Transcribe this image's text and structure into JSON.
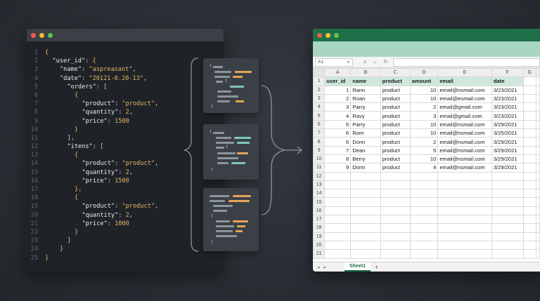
{
  "editor": {
    "lines": [
      {
        "n": "1",
        "indent": 0,
        "parts": [
          [
            "brace",
            "{"
          ]
        ]
      },
      {
        "n": "2",
        "indent": 1,
        "parts": [
          [
            "key",
            "\"user_id\""
          ],
          [
            "punct",
            ": "
          ],
          [
            "brace",
            "{"
          ]
        ]
      },
      {
        "n": "3",
        "indent": 2,
        "parts": [
          [
            "key",
            "\"name\""
          ],
          [
            "punct",
            ": "
          ],
          [
            "str",
            "\"aspreasant\""
          ],
          [
            "punct",
            ","
          ]
        ]
      },
      {
        "n": "4",
        "indent": 2,
        "parts": [
          [
            "key",
            "\"date\""
          ],
          [
            "punct",
            ": "
          ],
          [
            "str",
            "\"20121-0.20-13\""
          ],
          [
            "punct",
            ","
          ]
        ]
      },
      {
        "n": "5",
        "indent": 3,
        "parts": [
          [
            "key",
            "\"orders\""
          ],
          [
            "punct",
            ": ["
          ]
        ]
      },
      {
        "n": "6",
        "indent": 4,
        "parts": [
          [
            "brace",
            "{"
          ]
        ]
      },
      {
        "n": "7",
        "indent": 5,
        "parts": [
          [
            "key",
            "\"product\""
          ],
          [
            "punct",
            ": "
          ],
          [
            "str",
            "\"product\""
          ],
          [
            "punct",
            ","
          ]
        ]
      },
      {
        "n": "8",
        "indent": 5,
        "parts": [
          [
            "key",
            "\"quantity\""
          ],
          [
            "punct",
            ": "
          ],
          [
            "num",
            "2"
          ],
          [
            "punct",
            ","
          ]
        ]
      },
      {
        "n": "9",
        "indent": 5,
        "parts": [
          [
            "key",
            "\"price\""
          ],
          [
            "punct",
            ": "
          ],
          [
            "num",
            "1500"
          ]
        ]
      },
      {
        "n": "10",
        "indent": 4,
        "parts": [
          [
            "brace",
            "}"
          ]
        ]
      },
      {
        "n": "11",
        "indent": 3,
        "parts": [
          [
            "punct",
            "],"
          ]
        ]
      },
      {
        "n": "12",
        "indent": 3,
        "parts": [
          [
            "key",
            "\"itens\""
          ],
          [
            "punct",
            ": ["
          ]
        ]
      },
      {
        "n": "13",
        "indent": 4,
        "parts": [
          [
            "brace",
            "{"
          ]
        ]
      },
      {
        "n": "14",
        "indent": 5,
        "parts": [
          [
            "key",
            "\"product\""
          ],
          [
            "punct",
            ": "
          ],
          [
            "str",
            "\"product\""
          ],
          [
            "punct",
            ","
          ]
        ]
      },
      {
        "n": "15",
        "indent": 5,
        "parts": [
          [
            "key",
            "\"quantity\""
          ],
          [
            "punct",
            ": "
          ],
          [
            "num",
            "2"
          ],
          [
            "punct",
            ","
          ]
        ]
      },
      {
        "n": "16",
        "indent": 5,
        "parts": [
          [
            "key",
            "\"price\""
          ],
          [
            "punct",
            ": "
          ],
          [
            "num",
            "1500"
          ]
        ]
      },
      {
        "n": "17",
        "indent": 4,
        "parts": [
          [
            "brace",
            "},"
          ]
        ]
      },
      {
        "n": "18",
        "indent": 4,
        "parts": [
          [
            "brace",
            "{"
          ]
        ]
      },
      {
        "n": "19",
        "indent": 5,
        "parts": [
          [
            "key",
            "\"product\""
          ],
          [
            "punct",
            ": "
          ],
          [
            "str",
            "\"product\""
          ],
          [
            "punct",
            ","
          ]
        ]
      },
      {
        "n": "20",
        "indent": 5,
        "parts": [
          [
            "key",
            "\"quantity\""
          ],
          [
            "punct",
            ": "
          ],
          [
            "num",
            "2"
          ],
          [
            "punct",
            ","
          ]
        ]
      },
      {
        "n": "21",
        "indent": 5,
        "parts": [
          [
            "key",
            "\"price\""
          ],
          [
            "punct",
            ": "
          ],
          [
            "num",
            "1000"
          ]
        ]
      },
      {
        "n": "22",
        "indent": 4,
        "parts": [
          [
            "brace",
            "}"
          ]
        ]
      },
      {
        "n": "23",
        "indent": 3,
        "parts": [
          [
            "punct",
            "]"
          ]
        ]
      },
      {
        "n": "24",
        "indent": 2,
        "parts": [
          [
            "brace",
            "}"
          ]
        ]
      },
      {
        "n": "25",
        "indent": 0,
        "parts": [
          [
            "brace",
            "}"
          ]
        ]
      }
    ]
  },
  "sheet": {
    "name_box": "A1",
    "icons": {
      "cancel": "✕",
      "confirm": "✓",
      "function": "fx"
    },
    "columns": [
      "A",
      "B",
      "C",
      "D",
      "E",
      "F",
      "G"
    ],
    "headers": [
      "user_id",
      "name",
      "product",
      "amount",
      "email",
      "date",
      ""
    ],
    "rows": [
      [
        "1",
        "Rann",
        "product",
        "10",
        "email@nsmail.com",
        "3/23/2021",
        ""
      ],
      [
        "2",
        "Roan",
        "product",
        "10",
        "email@esmail.com",
        "3/23/2021",
        ""
      ],
      [
        "3",
        "Parry",
        "product",
        "2",
        "email@gmail.com",
        "3/23/2021",
        ""
      ],
      [
        "4",
        "Ravy",
        "product",
        "3",
        "email@gmail.com",
        "3/23/2021",
        ""
      ],
      [
        "5",
        "Parry",
        "product",
        "10",
        "email@nsmail.com",
        "3/29/2021",
        ""
      ],
      [
        "6",
        "Rom",
        "product",
        "10",
        "email@nsmail.com",
        "3/25/2021",
        ""
      ],
      [
        "6",
        "Donn",
        "product",
        "2",
        "email@nsmail.com",
        "3/29/2021",
        ""
      ],
      [
        "7",
        "Dean",
        "product",
        "5",
        "email@nsmail.com",
        "3/29/2021",
        ""
      ],
      [
        "8",
        "Berry",
        "product",
        "10",
        "email@nsmail.com",
        "3/29/2021",
        ""
      ],
      [
        "9",
        "Donn",
        "product",
        "4",
        "email@nsmail.com",
        "3/29/2021",
        ""
      ]
    ],
    "row_numbers": [
      "1",
      "2",
      "3",
      "4",
      "5",
      "6",
      "7",
      "8",
      "9",
      "10",
      "11",
      "12",
      "13",
      "14",
      "15",
      "16",
      "17",
      "18",
      "19",
      "20",
      "21"
    ],
    "tab_label": "Sheet1",
    "add_sheet": "+",
    "nav": [
      "◂",
      "▸"
    ]
  },
  "colors": {
    "excel_green": "#1e6e48",
    "ribbon": "#a9d6c0",
    "header_fill": "#cfe8db",
    "json_value": "#e7b565",
    "card_teal": "#7fc8b8"
  }
}
